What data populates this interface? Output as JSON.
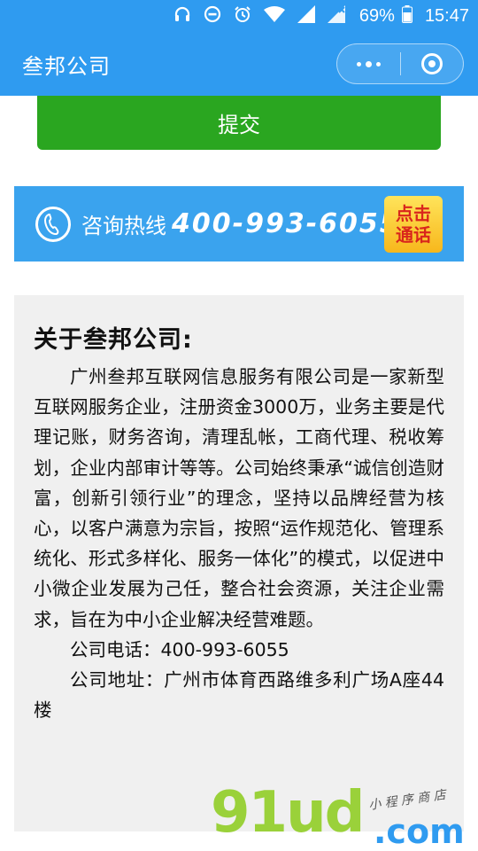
{
  "status_bar": {
    "battery": "69%",
    "time": "15:47"
  },
  "nav": {
    "title": "叁邦公司"
  },
  "form": {
    "submit_label": "提交"
  },
  "hotline": {
    "label": "咨询热线",
    "number": "400-993-6055",
    "call_line1": "点击",
    "call_line2": "通话"
  },
  "about": {
    "heading": "关于叁邦公司:",
    "body": "广州叁邦互联网信息服务有限公司是一家新型互联网服务企业，注册资金3000万，业务主要是代理记账，财务咨询，清理乱帐，工商代理、税收筹划，企业内部审计等等。公司始终秉承“诚信创造财富，创新引领行业”的理念，坚持以品牌经营为核心，以客户满意为宗旨，按照“运作规范化、管理系统化、形式多样化、服务一体化”的模式，以促进中小微企业发展为己任，整合社会资源，关注企业需求，旨在为中小企业解决经营难题。",
    "phone": "公司电话：400-993-6055",
    "address": "公司地址：广州市体育西路维多利广场A座44楼"
  },
  "watermark": {
    "brand": "91ud",
    "domain": ".com",
    "tagline": "小 程 序 商 店"
  }
}
